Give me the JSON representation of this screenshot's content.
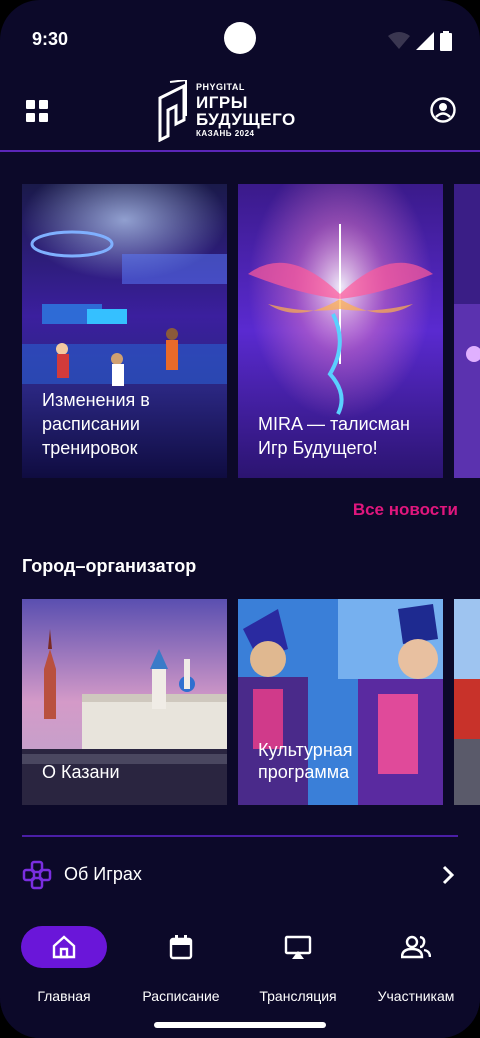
{
  "status_bar": {
    "time": "9:30"
  },
  "header": {
    "logo_top": "PHYGITAL",
    "logo_line1": "ИГРЫ",
    "logo_line2": "БУДУЩЕГО",
    "logo_bottom": "КАЗАНЬ 2024"
  },
  "news": {
    "items": [
      {
        "title": "Изменения в расписании тренировок"
      },
      {
        "title": "MIRA — талисман Игр Будущего!"
      }
    ],
    "all_news_label": "Все новости"
  },
  "city_section": {
    "title": "Город–организатор",
    "items": [
      {
        "title": "О Казани"
      },
      {
        "title": "Культурная программа"
      }
    ]
  },
  "about_row": {
    "label": "Об Играх"
  },
  "bottom_nav": {
    "items": [
      {
        "label": "Главная",
        "icon": "home-icon",
        "active": true
      },
      {
        "label": "Расписание",
        "icon": "calendar-icon",
        "active": false
      },
      {
        "label": "Трансляция",
        "icon": "cast-icon",
        "active": false
      },
      {
        "label": "Участникам",
        "icon": "people-icon",
        "active": false
      }
    ]
  },
  "colors": {
    "background": "#0c0929",
    "accent_purple": "#6a16d9",
    "link_pink": "#e0167d"
  }
}
